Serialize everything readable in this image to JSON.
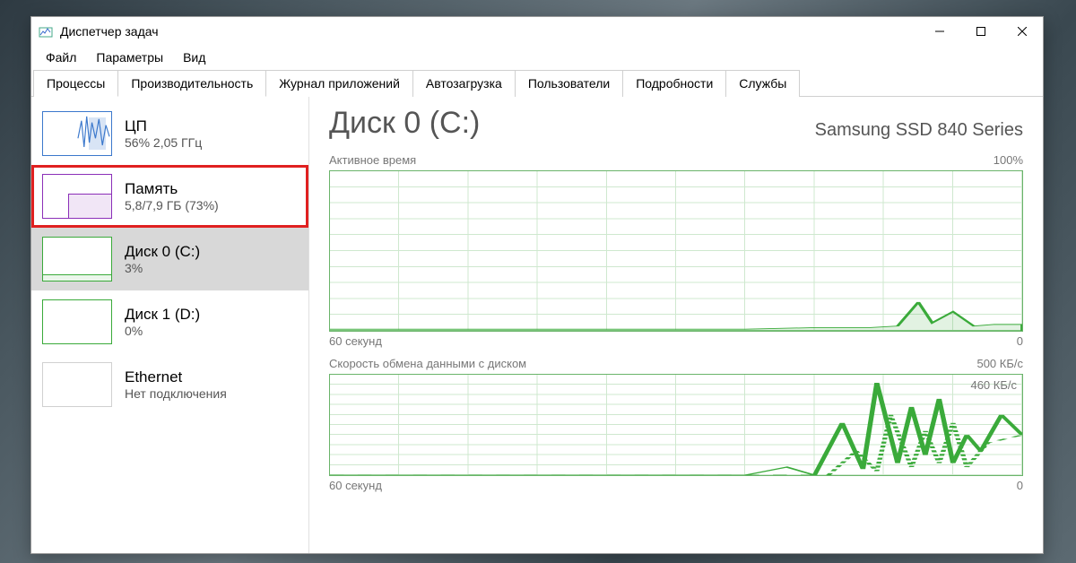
{
  "window": {
    "title": "Диспетчер задач"
  },
  "menu": {
    "file": "Файл",
    "options": "Параметры",
    "view": "Вид"
  },
  "tabs": {
    "processes": "Процессы",
    "performance": "Производительность",
    "app_history": "Журнал приложений",
    "startup": "Автозагрузка",
    "users": "Пользователи",
    "details": "Подробности",
    "services": "Службы"
  },
  "sidebar": {
    "cpu": {
      "title": "ЦП",
      "sub": "56%  2,05 ГГц"
    },
    "mem": {
      "title": "Память",
      "sub": "5,8/7,9 ГБ (73%)"
    },
    "disk0": {
      "title": "Диск 0 (C:)",
      "sub": "3%"
    },
    "disk1": {
      "title": "Диск 1 (D:)",
      "sub": "0%"
    },
    "eth": {
      "title": "Ethernet",
      "sub": "Нет подключения"
    }
  },
  "main": {
    "title": "Диск 0 (С:)",
    "model": "Samsung SSD 840 Series",
    "chart1": {
      "label": "Активное время",
      "max": "100%",
      "xleft": "60 секунд",
      "xright": "0"
    },
    "chart2": {
      "label": "Скорость обмена данными с диском",
      "max": "500 КБ/с",
      "peak": "460 КБ/с",
      "xleft": "60 секунд",
      "xright": "0"
    }
  },
  "chart_data": [
    {
      "type": "line",
      "title": "Активное время",
      "xlabel": "60 секунд → 0",
      "ylabel": "%",
      "ylim": [
        0,
        100
      ],
      "x_seconds_ago": [
        60,
        55,
        50,
        45,
        40,
        35,
        30,
        25,
        20,
        15,
        10,
        8,
        6,
        4,
        2,
        0
      ],
      "values": [
        1,
        1,
        1,
        1,
        1,
        1,
        1,
        2,
        2,
        2,
        3,
        18,
        5,
        12,
        3,
        4
      ]
    },
    {
      "type": "line",
      "title": "Скорость обмена данными с диском",
      "xlabel": "60 секунд → 0",
      "ylabel": "КБ/с",
      "ylim": [
        0,
        500
      ],
      "series": [
        {
          "name": "read",
          "x_seconds_ago": [
            60,
            50,
            40,
            30,
            20,
            15,
            12,
            10,
            8,
            7,
            6,
            5,
            4,
            3,
            2,
            1,
            0
          ],
          "values": [
            0,
            0,
            0,
            0,
            0,
            40,
            0,
            260,
            30,
            460,
            60,
            340,
            100,
            380,
            60,
            200,
            120
          ]
        },
        {
          "name": "write",
          "x_seconds_ago": [
            60,
            50,
            40,
            30,
            20,
            15,
            12,
            10,
            8,
            6,
            5,
            4,
            3,
            2,
            1,
            0
          ],
          "values": [
            0,
            0,
            0,
            0,
            0,
            0,
            0,
            120,
            20,
            300,
            40,
            220,
            60,
            260,
            40,
            160
          ],
          "style": "dashed"
        }
      ]
    }
  ]
}
